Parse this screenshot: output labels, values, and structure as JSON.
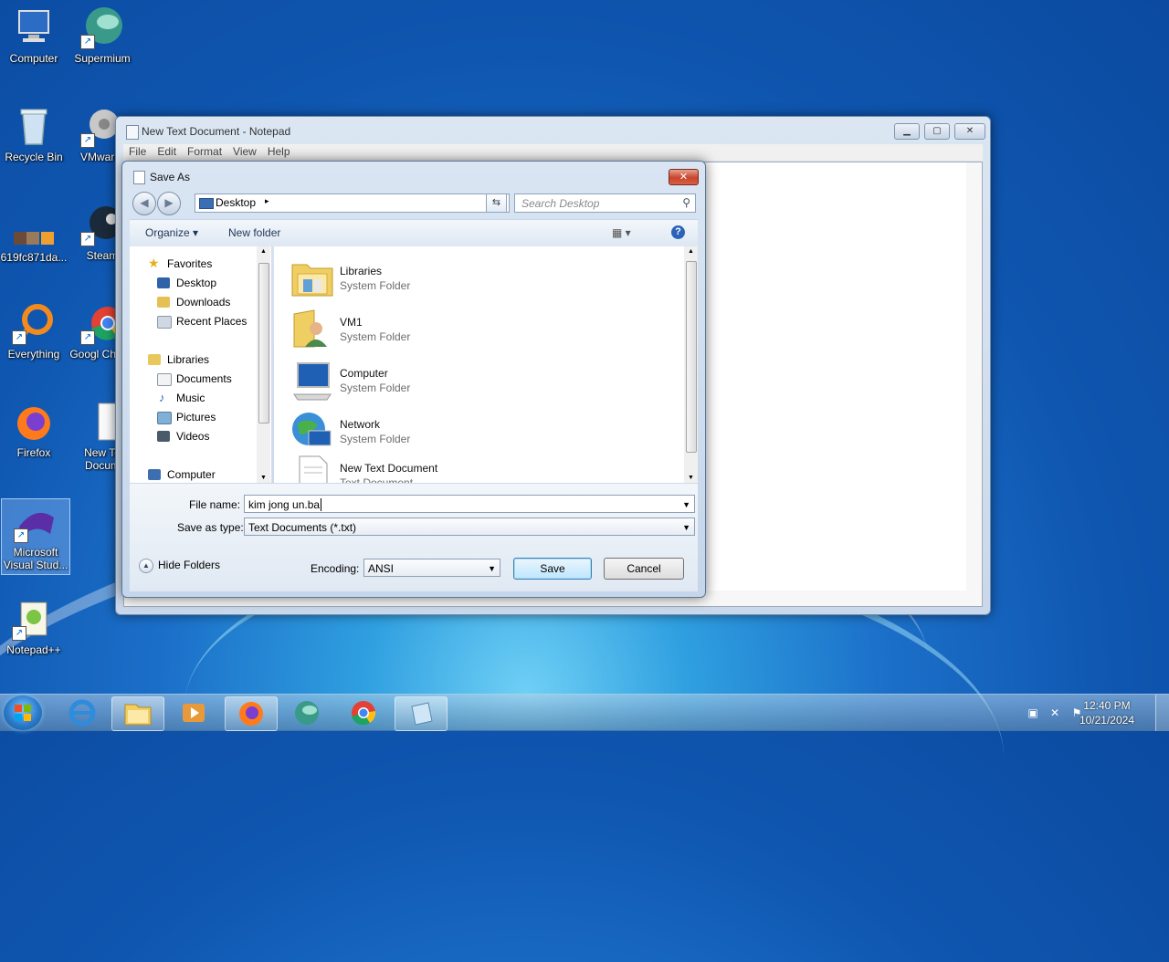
{
  "desktop": {
    "icons": [
      {
        "label": "Computer"
      },
      {
        "label": "Supermium"
      },
      {
        "label": "Recycle Bin"
      },
      {
        "label": "VMware-"
      },
      {
        "label": "619fc871da..."
      },
      {
        "label": "Steam"
      },
      {
        "label": "Everything"
      },
      {
        "label": "Googl Chrom"
      },
      {
        "label": "Firefox"
      },
      {
        "label": "New Te Docum"
      },
      {
        "label": "Microsoft Visual Stud..."
      },
      {
        "label": "Notepad++"
      }
    ]
  },
  "notepad": {
    "title": "New Text Document - Notepad",
    "menu": [
      "File",
      "Edit",
      "Format",
      "View",
      "Help"
    ],
    "min_glyph": "▁",
    "max_glyph": "▢",
    "close_glyph": "✕"
  },
  "dialog": {
    "title": "Save As",
    "close_glyph": "✕",
    "address": {
      "location": "Desktop",
      "arrow": "▸",
      "dropdown": "▾"
    },
    "search_placeholder": "Search Desktop",
    "toolbar": {
      "organize": "Organize ▾",
      "new_folder": "New folder",
      "view": "▦ ▾",
      "help": "?"
    },
    "nav": {
      "favorites_header": "Favorites",
      "favorites": [
        "Desktop",
        "Downloads",
        "Recent Places"
      ],
      "libraries_header": "Libraries",
      "libraries": [
        "Documents",
        "Music",
        "Pictures",
        "Videos"
      ],
      "computer_header": "Computer"
    },
    "files": [
      {
        "name": "Libraries",
        "type": "System Folder"
      },
      {
        "name": "VM1",
        "type": "System Folder"
      },
      {
        "name": "Computer",
        "type": "System Folder"
      },
      {
        "name": "Network",
        "type": "System Folder"
      },
      {
        "name": "New Text Document",
        "type": "Text Document"
      }
    ],
    "filename_label": "File name:",
    "filename_value": "kim jong un.ba",
    "savetype_label": "Save as type:",
    "savetype_value": "Text Documents (*.txt)",
    "encoding_label": "Encoding:",
    "encoding_value": "ANSI",
    "save_label": "Save",
    "cancel_label": "Cancel",
    "hide_folders_label": "Hide Folders"
  },
  "taskbar": {
    "time": "12:40 PM",
    "date": "10/21/2024"
  },
  "colors": {
    "accent": "#2a63b8",
    "close": "#c8452c"
  }
}
